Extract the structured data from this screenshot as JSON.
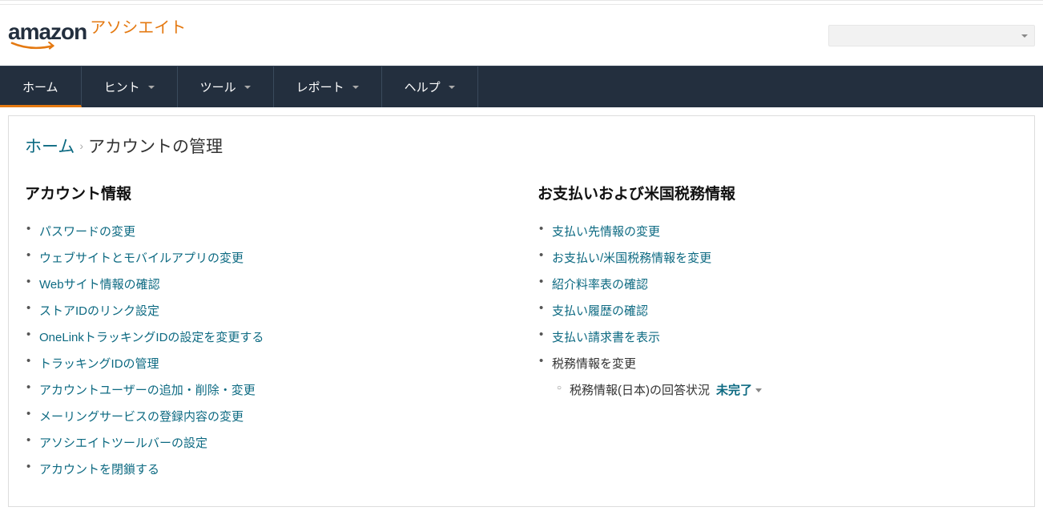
{
  "logo": {
    "text": "amazon",
    "suffix": "アソシエイト"
  },
  "nav": {
    "items": [
      {
        "label": "ホーム",
        "dropdown": false,
        "active": true
      },
      {
        "label": "ヒント",
        "dropdown": true,
        "active": false
      },
      {
        "label": "ツール",
        "dropdown": true,
        "active": false
      },
      {
        "label": "レポート",
        "dropdown": true,
        "active": false
      },
      {
        "label": "ヘルプ",
        "dropdown": true,
        "active": false
      }
    ]
  },
  "breadcrumb": {
    "home": "ホーム",
    "current": "アカウントの管理"
  },
  "account_section": {
    "heading": "アカウント情報",
    "links": [
      "パスワードの変更",
      "ウェブサイトとモバイルアプリの変更",
      "Webサイト情報の確認",
      "ストアIDのリンク設定",
      "OneLinkトラッキングIDの設定を変更する",
      "トラッキングIDの管理",
      "アカウントユーザーの追加・削除・変更",
      "メーリングサービスの登録内容の変更",
      "アソシエイトツールバーの設定",
      "アカウントを閉鎖する"
    ]
  },
  "payment_section": {
    "heading": "お支払いおよび米国税務情報",
    "links": [
      "支払い先情報の変更",
      "お支払い/米国税務情報を変更",
      "紹介料率表の確認",
      "支払い履歴の確認",
      "支払い請求書を表示"
    ],
    "tax_change_label": "税務情報を変更",
    "tax_jp_label": "税務情報(日本)の回答状況",
    "tax_jp_status": "未完了"
  }
}
